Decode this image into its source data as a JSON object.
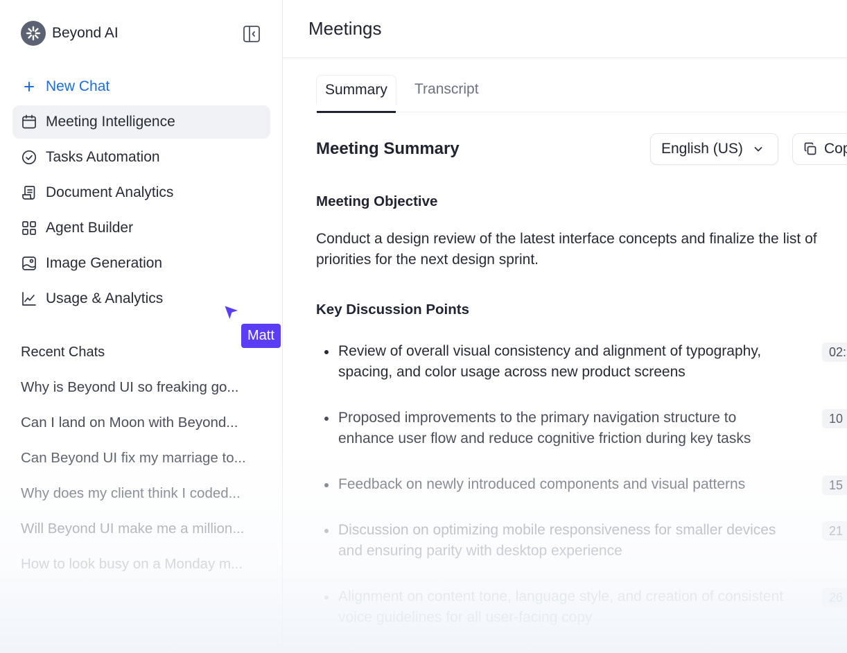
{
  "brand": {
    "name": "Beyond AI"
  },
  "sidebar": {
    "new_chat_label": "New Chat",
    "items": [
      {
        "label": "Meeting Intelligence",
        "icon": "calendar-icon",
        "active": true
      },
      {
        "label": "Tasks Automation",
        "icon": "check-circle-icon"
      },
      {
        "label": "Document Analytics",
        "icon": "document-icon"
      },
      {
        "label": "Agent Builder",
        "icon": "grid-icon"
      },
      {
        "label": "Image Generation",
        "icon": "image-icon"
      },
      {
        "label": "Usage & Analytics",
        "icon": "line-chart-icon"
      }
    ],
    "recent_title": "Recent Chats",
    "recent": [
      "Why is Beyond UI so freaking go...",
      "Can I land on Moon with Beyond...",
      "Can Beyond UI fix my marriage to...",
      "Why does my client think I coded...",
      "Will Beyond UI make me a million...",
      "How to look busy on a Monday m..."
    ]
  },
  "cursor": {
    "user_name": "Matt",
    "color": "#5b3df5"
  },
  "main": {
    "title": "Meetings",
    "tabs": [
      {
        "label": "Summary",
        "active": true
      },
      {
        "label": "Transcript",
        "active": false
      }
    ],
    "summary_title": "Meeting Summary",
    "language": "English (US)",
    "copy_label": "Copy",
    "objective_heading": "Meeting Objective",
    "objective_text": "Conduct a design review of the latest interface concepts and finalize the list of priorities for the next design sprint.",
    "points_heading": "Key Discussion Points",
    "points": [
      {
        "text": "Review of overall visual consistency and alignment of typography, spacing, and color usage across new product screens",
        "time": "02:"
      },
      {
        "text": "Proposed improvements to the primary navigation structure to enhance user flow and reduce cognitive friction during key tasks",
        "time": "10"
      },
      {
        "text": "Feedback on newly introduced components and visual patterns",
        "time": "15"
      },
      {
        "text": "Discussion on optimizing mobile responsiveness for smaller devices and ensuring parity with desktop experience",
        "time": "21"
      },
      {
        "text": "Alignment on content tone, language style, and creation of consistent voice guidelines for all user-facing copy",
        "time": "26"
      }
    ]
  },
  "colors": {
    "accent": "#1a6fe0",
    "cursor": "#5b3df5",
    "active_bg": "#f1f2f5"
  }
}
